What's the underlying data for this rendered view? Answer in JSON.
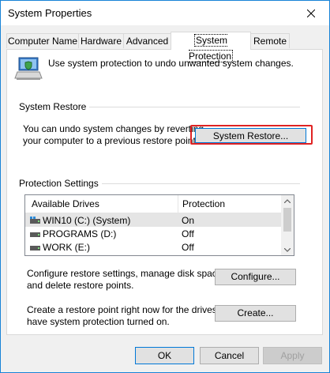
{
  "window": {
    "title": "System Properties",
    "close_glyph": "✕"
  },
  "tabs": [
    {
      "label": "Computer Name",
      "active": false
    },
    {
      "label": "Hardware",
      "active": false
    },
    {
      "label": "Advanced",
      "active": false
    },
    {
      "label": "System Protection",
      "active": true
    },
    {
      "label": "Remote",
      "active": false
    }
  ],
  "intro": {
    "icon": "system-protection-computer-icon",
    "text": "Use system protection to undo unwanted system changes."
  },
  "system_restore": {
    "group_label": "System Restore",
    "description_line1": "You can undo system changes by reverting",
    "description_line2": "your computer to a previous restore point.",
    "button_label": "System Restore...",
    "highlight_color": "#e02323"
  },
  "protection_settings": {
    "group_label": "Protection Settings",
    "columns": [
      "Available Drives",
      "Protection"
    ],
    "drives": [
      {
        "name": "WIN10 (C:) (System)",
        "protection": "On",
        "icon": "system-drive-icon",
        "selected": true
      },
      {
        "name": "PROGRAMS (D:)",
        "protection": "Off",
        "icon": "drive-icon",
        "selected": false
      },
      {
        "name": "WORK (E:)",
        "protection": "Off",
        "icon": "drive-icon",
        "selected": false
      }
    ],
    "configure_text_line1": "Configure restore settings, manage disk space,",
    "configure_text_line2": "and delete restore points.",
    "configure_button": "Configure...",
    "create_text_line1": "Create a restore point right now for the drives that",
    "create_text_line2": "have system protection turned on.",
    "create_button": "Create..."
  },
  "footer": {
    "ok": "OK",
    "cancel": "Cancel",
    "apply": "Apply"
  },
  "colors": {
    "window_border": "#1883d7",
    "focus_border": "#0078d7"
  }
}
